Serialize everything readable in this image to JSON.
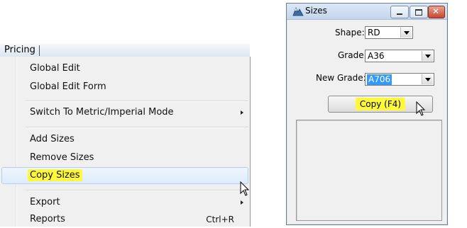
{
  "menu": {
    "menubar_label": "Pricing",
    "items": [
      {
        "label": "Global Edit"
      },
      {
        "label": "Global Edit Form"
      },
      {
        "label": "Switch To Metric/Imperial Mode"
      },
      {
        "label": "Add Sizes"
      },
      {
        "label": "Remove Sizes"
      },
      {
        "label": "Copy Sizes",
        "highlighted": true
      },
      {
        "label": "Export"
      },
      {
        "label": "Reports",
        "shortcut": "Ctrl+R"
      }
    ]
  },
  "window": {
    "title": "Sizes",
    "fields": {
      "shape": {
        "label": "Shape:",
        "value": "RD"
      },
      "grade": {
        "label": "Grade:",
        "value": "A36"
      },
      "new_grade": {
        "label": "New Grade:",
        "value": "A706"
      }
    },
    "copy_button_label": "Copy (F4)"
  },
  "colors": {
    "highlight": "#fff83c",
    "menu_background": "#f0f0f0",
    "hover_border": "#aecff7",
    "selection": "#3399ff",
    "close_button": "#c7472e"
  },
  "icons": [
    "submenu-arrow-icon",
    "mouse-pointer-icon",
    "window-app-icon",
    "minimize-icon",
    "maximize-icon",
    "close-icon",
    "dropdown-arrow-icon"
  ]
}
